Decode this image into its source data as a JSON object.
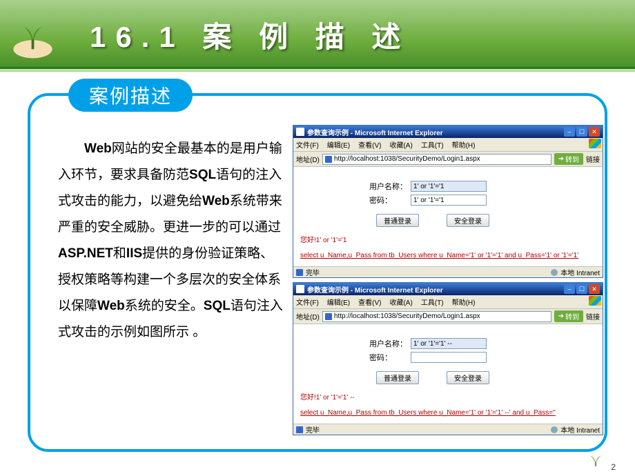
{
  "header": {
    "title": "16.1 案 例 描 述"
  },
  "pill": "案例描述",
  "paragraph": "Web网站的安全最基本的是用户输入环节，要求具备防范SQL语句的注入式攻击的能力，以避免给Web系统带来严重的安全威胁。更进一步的可以通过ASP.NET和IIS提供的身份验证策略、授权策略等构建一个多层次的安全体系以保障Web系统的安全。SQL语句注入式攻击的示例如图所示 。",
  "page_number": "2",
  "ie_common": {
    "title": "参数查询示例 - Microsoft Internet Explorer",
    "menus": [
      "文件(F)",
      "编辑(E)",
      "查看(V)",
      "收藏(A)",
      "工具(T)",
      "帮助(H)"
    ],
    "addr_label": "地址(D)",
    "url": "http://localhost:1038/SecurityDemo/Login1.aspx",
    "go_label": "转到",
    "links_label": "链接",
    "done_label": "完毕",
    "zone_label": "本地 Intranet",
    "form": {
      "username_label": "用户名称：",
      "password_label": "密码：",
      "btn_normal": "普通登录",
      "btn_secure": "安全登录"
    }
  },
  "shot1": {
    "username_value": "1' or '1'='1",
    "password_value": "1' or '1'='1",
    "greeting": "您好!1' or '1'='1",
    "sql": "select u_Name,u_Pass from tb_Users where u_Name='1' or '1'='1' and u_Pass='1' or '1'='1'"
  },
  "shot2": {
    "username_value": "1' or '1'='1' --",
    "password_value": "",
    "greeting": "您好!1' or '1'='1' --",
    "sql": "select u_Name,u_Pass from tb_Users where u_Name='1' or '1'='1' --' and u_Pass=''"
  }
}
